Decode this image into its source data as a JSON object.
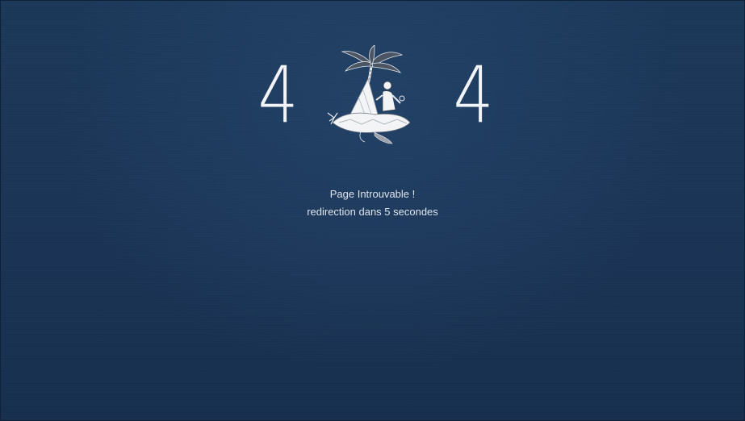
{
  "error": {
    "digit_first": "4",
    "digit_last": "4",
    "illustration_icon": "castaway-island-icon"
  },
  "message": {
    "title": "Page Introuvable !",
    "subtitle": "redirection dans 5 secondes"
  },
  "colors": {
    "background": "#1a3556",
    "text": "#dde4ec",
    "digits": "#f2f4f7"
  }
}
